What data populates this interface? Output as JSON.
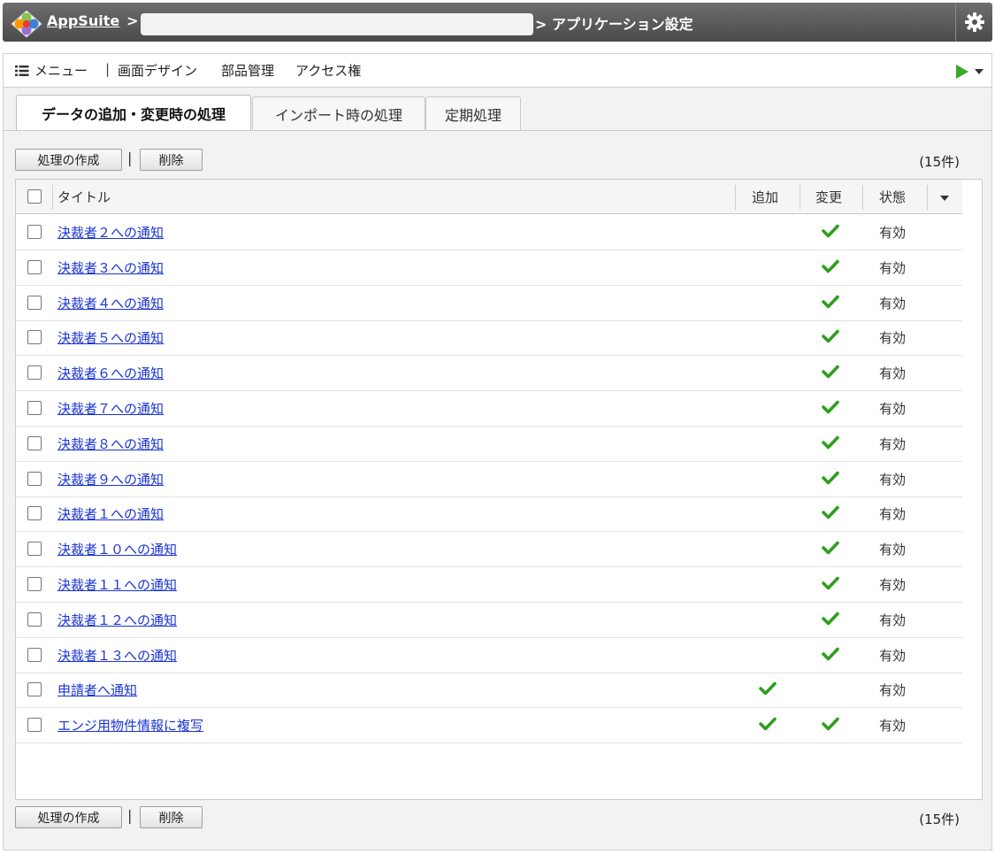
{
  "header": {
    "app_name": "AppSuite",
    "separator": ">",
    "page_title": "> アプリケーション設定"
  },
  "menu": {
    "items": [
      "メニュー",
      "画面デザイン",
      "部品管理",
      "アクセス権"
    ],
    "pipe": "|"
  },
  "tabs": [
    "データの追加・変更時の処理",
    "インポート時の処理",
    "定期処理"
  ],
  "toolbar": {
    "create_label": "処理の作成",
    "delete_label": "削除",
    "pipe": "|",
    "count": "(15件)"
  },
  "table": {
    "columns": {
      "title": "タイトル",
      "add": "追加",
      "change": "変更",
      "status": "状態"
    },
    "rows": [
      {
        "title": "決裁者２への通知",
        "add": false,
        "change": true,
        "status": "有効"
      },
      {
        "title": "決裁者３への通知",
        "add": false,
        "change": true,
        "status": "有効"
      },
      {
        "title": "決裁者４への通知",
        "add": false,
        "change": true,
        "status": "有効"
      },
      {
        "title": "決裁者５への通知",
        "add": false,
        "change": true,
        "status": "有効"
      },
      {
        "title": "決裁者６への通知",
        "add": false,
        "change": true,
        "status": "有効"
      },
      {
        "title": "決裁者７への通知",
        "add": false,
        "change": true,
        "status": "有効"
      },
      {
        "title": "決裁者８への通知",
        "add": false,
        "change": true,
        "status": "有効"
      },
      {
        "title": "決裁者９への通知",
        "add": false,
        "change": true,
        "status": "有効"
      },
      {
        "title": "決裁者１への通知",
        "add": false,
        "change": true,
        "status": "有効"
      },
      {
        "title": "決裁者１０への通知",
        "add": false,
        "change": true,
        "status": "有効"
      },
      {
        "title": "決裁者１１への通知",
        "add": false,
        "change": true,
        "status": "有効"
      },
      {
        "title": "決裁者１２への通知",
        "add": false,
        "change": true,
        "status": "有効"
      },
      {
        "title": "決裁者１３への通知",
        "add": false,
        "change": true,
        "status": "有効"
      },
      {
        "title": "申請者へ通知",
        "add": true,
        "change": false,
        "status": "有効"
      },
      {
        "title": "エンジ用物件情報に複写",
        "add": true,
        "change": true,
        "status": "有効"
      }
    ]
  },
  "colors": {
    "titlebar": "#5a5a5a",
    "link": "#1a34d6",
    "check": "#2e9e1e",
    "play": "#3aa829"
  },
  "icons": [
    "app-logo-icon",
    "gear-icon",
    "list-icon",
    "play-icon",
    "caret-down-icon",
    "check-icon"
  ]
}
